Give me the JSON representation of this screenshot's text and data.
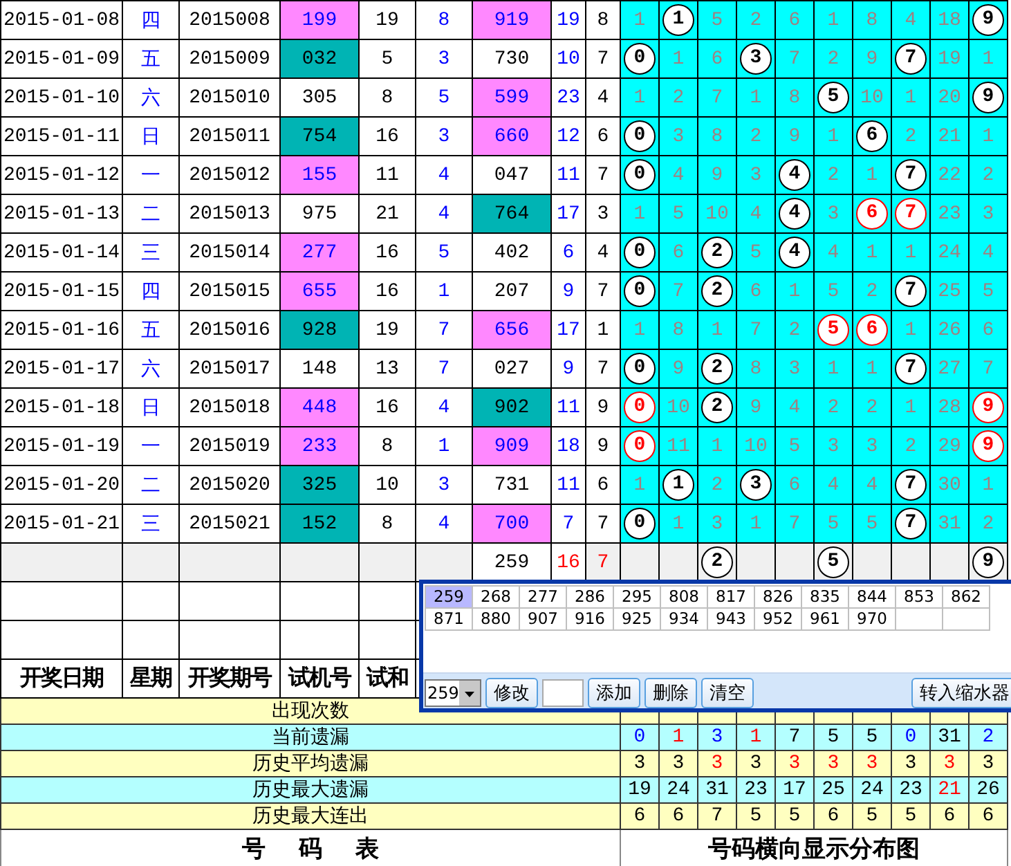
{
  "draw_rows": [
    {
      "date": "2015-01-08",
      "weekday": "四",
      "issue": "2015008",
      "trial_number": {
        "value": "199",
        "color": "#ff88ff"
      },
      "trial_sum": "19",
      "column_6": "8",
      "winning_number": {
        "value": "919",
        "color": "#ff88ff"
      },
      "sum": "19",
      "span": "8",
      "digits": [
        {
          "text": "1",
          "kind": "plain"
        },
        {
          "text": "1",
          "kind": "ball"
        },
        {
          "text": "5",
          "kind": "plain"
        },
        {
          "text": "2",
          "kind": "plain"
        },
        {
          "text": "6",
          "kind": "plain"
        },
        {
          "text": "1",
          "kind": "plain"
        },
        {
          "text": "8",
          "kind": "plain"
        },
        {
          "text": "4",
          "kind": "plain"
        },
        {
          "text": "18",
          "kind": "plain"
        },
        {
          "text": "9",
          "kind": "ball"
        }
      ]
    },
    {
      "date": "2015-01-09",
      "weekday": "五",
      "issue": "2015009",
      "trial_number": {
        "value": "032",
        "color": "#00b4b4"
      },
      "trial_sum": "5",
      "column_6": "3",
      "winning_number": {
        "value": "730",
        "color": "#ffffff"
      },
      "sum": "10",
      "span": "7",
      "digits": [
        {
          "text": "0",
          "kind": "ball"
        },
        {
          "text": "1",
          "kind": "plain"
        },
        {
          "text": "6",
          "kind": "plain"
        },
        {
          "text": "3",
          "kind": "ball"
        },
        {
          "text": "7",
          "kind": "plain"
        },
        {
          "text": "2",
          "kind": "plain"
        },
        {
          "text": "9",
          "kind": "plain"
        },
        {
          "text": "7",
          "kind": "ball"
        },
        {
          "text": "19",
          "kind": "plain"
        },
        {
          "text": "1",
          "kind": "plain"
        }
      ]
    },
    {
      "date": "2015-01-10",
      "weekday": "六",
      "issue": "2015010",
      "trial_number": {
        "value": "305",
        "color": "#ffffff"
      },
      "trial_sum": "8",
      "column_6": "5",
      "winning_number": {
        "value": "599",
        "color": "#ff88ff"
      },
      "sum": "23",
      "span": "4",
      "digits": [
        {
          "text": "1",
          "kind": "plain"
        },
        {
          "text": "2",
          "kind": "plain"
        },
        {
          "text": "7",
          "kind": "plain"
        },
        {
          "text": "1",
          "kind": "plain"
        },
        {
          "text": "8",
          "kind": "plain"
        },
        {
          "text": "5",
          "kind": "ball"
        },
        {
          "text": "10",
          "kind": "plain"
        },
        {
          "text": "1",
          "kind": "plain"
        },
        {
          "text": "20",
          "kind": "plain"
        },
        {
          "text": "9",
          "kind": "ball"
        }
      ]
    },
    {
      "date": "2015-01-11",
      "weekday": "日",
      "issue": "2015011",
      "trial_number": {
        "value": "754",
        "color": "#00b4b4"
      },
      "trial_sum": "16",
      "column_6": "3",
      "winning_number": {
        "value": "660",
        "color": "#ff88ff"
      },
      "sum": "12",
      "span": "6",
      "digits": [
        {
          "text": "0",
          "kind": "ball"
        },
        {
          "text": "3",
          "kind": "plain"
        },
        {
          "text": "8",
          "kind": "plain"
        },
        {
          "text": "2",
          "kind": "plain"
        },
        {
          "text": "9",
          "kind": "plain"
        },
        {
          "text": "1",
          "kind": "plain"
        },
        {
          "text": "6",
          "kind": "ball"
        },
        {
          "text": "2",
          "kind": "plain"
        },
        {
          "text": "21",
          "kind": "plain"
        },
        {
          "text": "1",
          "kind": "plain"
        }
      ]
    },
    {
      "date": "2015-01-12",
      "weekday": "一",
      "issue": "2015012",
      "trial_number": {
        "value": "155",
        "color": "#ff88ff"
      },
      "trial_sum": "11",
      "column_6": "4",
      "winning_number": {
        "value": "047",
        "color": "#ffffff"
      },
      "sum": "11",
      "span": "7",
      "digits": [
        {
          "text": "0",
          "kind": "ball"
        },
        {
          "text": "4",
          "kind": "plain"
        },
        {
          "text": "9",
          "kind": "plain"
        },
        {
          "text": "3",
          "kind": "plain"
        },
        {
          "text": "4",
          "kind": "ball"
        },
        {
          "text": "2",
          "kind": "plain"
        },
        {
          "text": "1",
          "kind": "plain"
        },
        {
          "text": "7",
          "kind": "ball"
        },
        {
          "text": "22",
          "kind": "plain"
        },
        {
          "text": "2",
          "kind": "plain"
        }
      ]
    },
    {
      "date": "2015-01-13",
      "weekday": "二",
      "issue": "2015013",
      "trial_number": {
        "value": "975",
        "color": "#ffffff"
      },
      "trial_sum": "21",
      "column_6": "4",
      "winning_number": {
        "value": "764",
        "color": "#00b4b4"
      },
      "sum": "17",
      "span": "3",
      "digits": [
        {
          "text": "1",
          "kind": "plain"
        },
        {
          "text": "5",
          "kind": "plain"
        },
        {
          "text": "10",
          "kind": "plain"
        },
        {
          "text": "4",
          "kind": "plain"
        },
        {
          "text": "4",
          "kind": "ball"
        },
        {
          "text": "3",
          "kind": "plain"
        },
        {
          "text": "6",
          "kind": "red-ball"
        },
        {
          "text": "7",
          "kind": "red-ball"
        },
        {
          "text": "23",
          "kind": "plain"
        },
        {
          "text": "3",
          "kind": "plain"
        }
      ]
    },
    {
      "date": "2015-01-14",
      "weekday": "三",
      "issue": "2015014",
      "trial_number": {
        "value": "277",
        "color": "#ff88ff"
      },
      "trial_sum": "16",
      "column_6": "5",
      "winning_number": {
        "value": "402",
        "color": "#ffffff"
      },
      "sum": "6",
      "span": "4",
      "digits": [
        {
          "text": "0",
          "kind": "ball"
        },
        {
          "text": "6",
          "kind": "plain"
        },
        {
          "text": "2",
          "kind": "ball"
        },
        {
          "text": "5",
          "kind": "plain"
        },
        {
          "text": "4",
          "kind": "ball"
        },
        {
          "text": "4",
          "kind": "plain"
        },
        {
          "text": "1",
          "kind": "plain"
        },
        {
          "text": "1",
          "kind": "plain"
        },
        {
          "text": "24",
          "kind": "plain"
        },
        {
          "text": "4",
          "kind": "plain"
        }
      ]
    },
    {
      "date": "2015-01-15",
      "weekday": "四",
      "issue": "2015015",
      "trial_number": {
        "value": "655",
        "color": "#ff88ff"
      },
      "trial_sum": "16",
      "column_6": "1",
      "winning_number": {
        "value": "207",
        "color": "#ffffff"
      },
      "sum": "9",
      "span": "7",
      "digits": [
        {
          "text": "0",
          "kind": "ball"
        },
        {
          "text": "7",
          "kind": "plain"
        },
        {
          "text": "2",
          "kind": "ball"
        },
        {
          "text": "6",
          "kind": "plain"
        },
        {
          "text": "1",
          "kind": "plain"
        },
        {
          "text": "5",
          "kind": "plain"
        },
        {
          "text": "2",
          "kind": "plain"
        },
        {
          "text": "7",
          "kind": "ball"
        },
        {
          "text": "25",
          "kind": "plain"
        },
        {
          "text": "5",
          "kind": "plain"
        }
      ]
    },
    {
      "date": "2015-01-16",
      "weekday": "五",
      "issue": "2015016",
      "trial_number": {
        "value": "928",
        "color": "#00b4b4"
      },
      "trial_sum": "19",
      "column_6": "7",
      "winning_number": {
        "value": "656",
        "color": "#ff88ff"
      },
      "sum": "17",
      "span": "1",
      "digits": [
        {
          "text": "1",
          "kind": "plain"
        },
        {
          "text": "8",
          "kind": "plain"
        },
        {
          "text": "1",
          "kind": "plain"
        },
        {
          "text": "7",
          "kind": "plain"
        },
        {
          "text": "2",
          "kind": "plain"
        },
        {
          "text": "5",
          "kind": "red-ball"
        },
        {
          "text": "6",
          "kind": "red-ball"
        },
        {
          "text": "1",
          "kind": "plain"
        },
        {
          "text": "26",
          "kind": "plain"
        },
        {
          "text": "6",
          "kind": "plain"
        }
      ]
    },
    {
      "date": "2015-01-17",
      "weekday": "六",
      "issue": "2015017",
      "trial_number": {
        "value": "148",
        "color": "#ffffff"
      },
      "trial_sum": "13",
      "column_6": "7",
      "winning_number": {
        "value": "027",
        "color": "#ffffff"
      },
      "sum": "9",
      "span": "7",
      "digits": [
        {
          "text": "0",
          "kind": "ball"
        },
        {
          "text": "9",
          "kind": "plain"
        },
        {
          "text": "2",
          "kind": "ball"
        },
        {
          "text": "8",
          "kind": "plain"
        },
        {
          "text": "3",
          "kind": "plain"
        },
        {
          "text": "1",
          "kind": "plain"
        },
        {
          "text": "1",
          "kind": "plain"
        },
        {
          "text": "7",
          "kind": "ball"
        },
        {
          "text": "27",
          "kind": "plain"
        },
        {
          "text": "7",
          "kind": "plain"
        }
      ]
    },
    {
      "date": "2015-01-18",
      "weekday": "日",
      "issue": "2015018",
      "trial_number": {
        "value": "448",
        "color": "#ff88ff"
      },
      "trial_sum": "16",
      "column_6": "4",
      "winning_number": {
        "value": "902",
        "color": "#00b4b4"
      },
      "sum": "11",
      "span": "9",
      "digits": [
        {
          "text": "0",
          "kind": "red-ball"
        },
        {
          "text": "10",
          "kind": "plain"
        },
        {
          "text": "2",
          "kind": "ball"
        },
        {
          "text": "9",
          "kind": "plain"
        },
        {
          "text": "4",
          "kind": "plain"
        },
        {
          "text": "2",
          "kind": "plain"
        },
        {
          "text": "2",
          "kind": "plain"
        },
        {
          "text": "1",
          "kind": "plain"
        },
        {
          "text": "28",
          "kind": "plain"
        },
        {
          "text": "9",
          "kind": "red-ball"
        }
      ]
    },
    {
      "date": "2015-01-19",
      "weekday": "一",
      "issue": "2015019",
      "trial_number": {
        "value": "233",
        "color": "#ff88ff"
      },
      "trial_sum": "8",
      "column_6": "1",
      "winning_number": {
        "value": "909",
        "color": "#ff88ff"
      },
      "sum": "18",
      "span": "9",
      "digits": [
        {
          "text": "0",
          "kind": "red-ball"
        },
        {
          "text": "11",
          "kind": "plain"
        },
        {
          "text": "1",
          "kind": "plain"
        },
        {
          "text": "10",
          "kind": "plain"
        },
        {
          "text": "5",
          "kind": "plain"
        },
        {
          "text": "3",
          "kind": "plain"
        },
        {
          "text": "3",
          "kind": "plain"
        },
        {
          "text": "2",
          "kind": "plain"
        },
        {
          "text": "29",
          "kind": "plain"
        },
        {
          "text": "9",
          "kind": "red-ball"
        }
      ]
    },
    {
      "date": "2015-01-20",
      "weekday": "二",
      "issue": "2015020",
      "trial_number": {
        "value": "325",
        "color": "#00b4b4"
      },
      "trial_sum": "10",
      "column_6": "3",
      "winning_number": {
        "value": "731",
        "color": "#ffffff"
      },
      "sum": "11",
      "span": "6",
      "digits": [
        {
          "text": "1",
          "kind": "plain"
        },
        {
          "text": "1",
          "kind": "ball"
        },
        {
          "text": "2",
          "kind": "plain"
        },
        {
          "text": "3",
          "kind": "ball"
        },
        {
          "text": "6",
          "kind": "plain"
        },
        {
          "text": "4",
          "kind": "plain"
        },
        {
          "text": "4",
          "kind": "plain"
        },
        {
          "text": "7",
          "kind": "ball"
        },
        {
          "text": "30",
          "kind": "plain"
        },
        {
          "text": "1",
          "kind": "plain"
        }
      ]
    },
    {
      "date": "2015-01-21",
      "weekday": "三",
      "issue": "2015021",
      "trial_number": {
        "value": "152",
        "color": "#00b4b4"
      },
      "trial_sum": "8",
      "column_6": "4",
      "winning_number": {
        "value": "700",
        "color": "#ff88ff"
      },
      "sum": "7",
      "span": "7",
      "digits": [
        {
          "text": "0",
          "kind": "ball"
        },
        {
          "text": "1",
          "kind": "plain"
        },
        {
          "text": "3",
          "kind": "plain"
        },
        {
          "text": "1",
          "kind": "plain"
        },
        {
          "text": "7",
          "kind": "plain"
        },
        {
          "text": "5",
          "kind": "plain"
        },
        {
          "text": "5",
          "kind": "plain"
        },
        {
          "text": "7",
          "kind": "ball"
        },
        {
          "text": "31",
          "kind": "plain"
        },
        {
          "text": "2",
          "kind": "plain"
        }
      ]
    }
  ],
  "summary_row": {
    "winning_number": "259",
    "sum": "16",
    "span": "7",
    "digits": [
      {
        "kind": "empty"
      },
      {
        "kind": "empty"
      },
      {
        "text": "2",
        "kind": "ball"
      },
      {
        "kind": "empty"
      },
      {
        "kind": "empty"
      },
      {
        "text": "5",
        "kind": "ball"
      },
      {
        "kind": "empty"
      },
      {
        "kind": "empty"
      },
      {
        "kind": "empty"
      },
      {
        "text": "9",
        "kind": "ball"
      }
    ]
  },
  "headers": [
    "开奖日期",
    "星期",
    "开奖期号",
    "试机号",
    "试和"
  ],
  "stats": [
    {
      "label": "出现次数",
      "color": "#ffffc0"
    },
    {
      "label": "当前遗漏",
      "color": "#b4ffff",
      "values": [
        {
          "text": "0",
          "color": "#0000ff"
        },
        {
          "text": "1",
          "color": "#ff0000"
        },
        {
          "text": "3",
          "color": "#0000ff"
        },
        {
          "text": "1",
          "color": "#ff0000"
        },
        {
          "text": "7",
          "color": "#000000"
        },
        {
          "text": "5",
          "color": "#000000"
        },
        {
          "text": "5",
          "color": "#000000"
        },
        {
          "text": "0",
          "color": "#0000ff"
        },
        {
          "text": "31",
          "color": "#000000"
        },
        {
          "text": "2",
          "color": "#0000ff"
        }
      ]
    },
    {
      "label": "历史平均遗漏",
      "color": "#ffffc0",
      "values": [
        {
          "text": "3",
          "color": "#000000"
        },
        {
          "text": "3",
          "color": "#000000"
        },
        {
          "text": "3",
          "color": "#ff0000"
        },
        {
          "text": "3",
          "color": "#000000"
        },
        {
          "text": "3",
          "color": "#ff0000"
        },
        {
          "text": "3",
          "color": "#ff0000"
        },
        {
          "text": "3",
          "color": "#ff0000"
        },
        {
          "text": "3",
          "color": "#000000"
        },
        {
          "text": "3",
          "color": "#ff0000"
        },
        {
          "text": "3",
          "color": "#000000"
        }
      ]
    },
    {
      "label": "历史最大遗漏",
      "color": "#b4ffff",
      "values": [
        {
          "text": "19",
          "color": "#000000"
        },
        {
          "text": "24",
          "color": "#000000"
        },
        {
          "text": "31",
          "color": "#000000"
        },
        {
          "text": "23",
          "color": "#000000"
        },
        {
          "text": "17",
          "color": "#000000"
        },
        {
          "text": "25",
          "color": "#000000"
        },
        {
          "text": "24",
          "color": "#000000"
        },
        {
          "text": "23",
          "color": "#000000"
        },
        {
          "text": "21",
          "color": "#ff0000"
        },
        {
          "text": "26",
          "color": "#000000"
        }
      ]
    },
    {
      "label": "历史最大连出",
      "color": "#ffffc0",
      "values": [
        {
          "text": "6",
          "color": "#000000"
        },
        {
          "text": "6",
          "color": "#000000"
        },
        {
          "text": "7",
          "color": "#000000"
        },
        {
          "text": "5",
          "color": "#000000"
        },
        {
          "text": "5",
          "color": "#000000"
        },
        {
          "text": "6",
          "color": "#000000"
        },
        {
          "text": "5",
          "color": "#000000"
        },
        {
          "text": "5",
          "color": "#000000"
        },
        {
          "text": "6",
          "color": "#000000"
        },
        {
          "text": "6",
          "color": "#000000"
        }
      ]
    }
  ],
  "footer": [
    "号 码 表",
    "号码横向显示分布图"
  ],
  "candidate_window": {
    "numbers": [
      {
        "text": "259",
        "selected": true
      },
      {
        "text": "268",
        "selected": false
      },
      {
        "text": "277",
        "selected": false
      },
      {
        "text": "286",
        "selected": false
      },
      {
        "text": "295",
        "selected": false
      },
      {
        "text": "808",
        "selected": false
      },
      {
        "text": "817",
        "selected": false
      },
      {
        "text": "826",
        "selected": false
      },
      {
        "text": "835",
        "selected": false
      },
      {
        "text": "844",
        "selected": false
      },
      {
        "text": "853",
        "selected": false
      },
      {
        "text": "862",
        "selected": false
      },
      {
        "text": "871",
        "selected": false
      },
      {
        "text": "880",
        "selected": false
      },
      {
        "text": "907",
        "selected": false
      },
      {
        "text": "916",
        "selected": false
      },
      {
        "text": "925",
        "selected": false
      },
      {
        "text": "934",
        "selected": false
      },
      {
        "text": "943",
        "selected": false
      },
      {
        "text": "952",
        "selected": false
      },
      {
        "text": "961",
        "selected": false
      },
      {
        "text": "970",
        "selected": false
      }
    ],
    "combo_value": "259",
    "controls": [
      {
        "kind": "button",
        "label": "修改"
      },
      {
        "kind": "input"
      },
      {
        "kind": "button",
        "label": "添加"
      },
      {
        "kind": "button",
        "label": "删除"
      },
      {
        "kind": "button",
        "label": "清空"
      },
      {
        "kind": "spacer"
      },
      {
        "kind": "button",
        "label": "转入缩水器"
      }
    ]
  }
}
